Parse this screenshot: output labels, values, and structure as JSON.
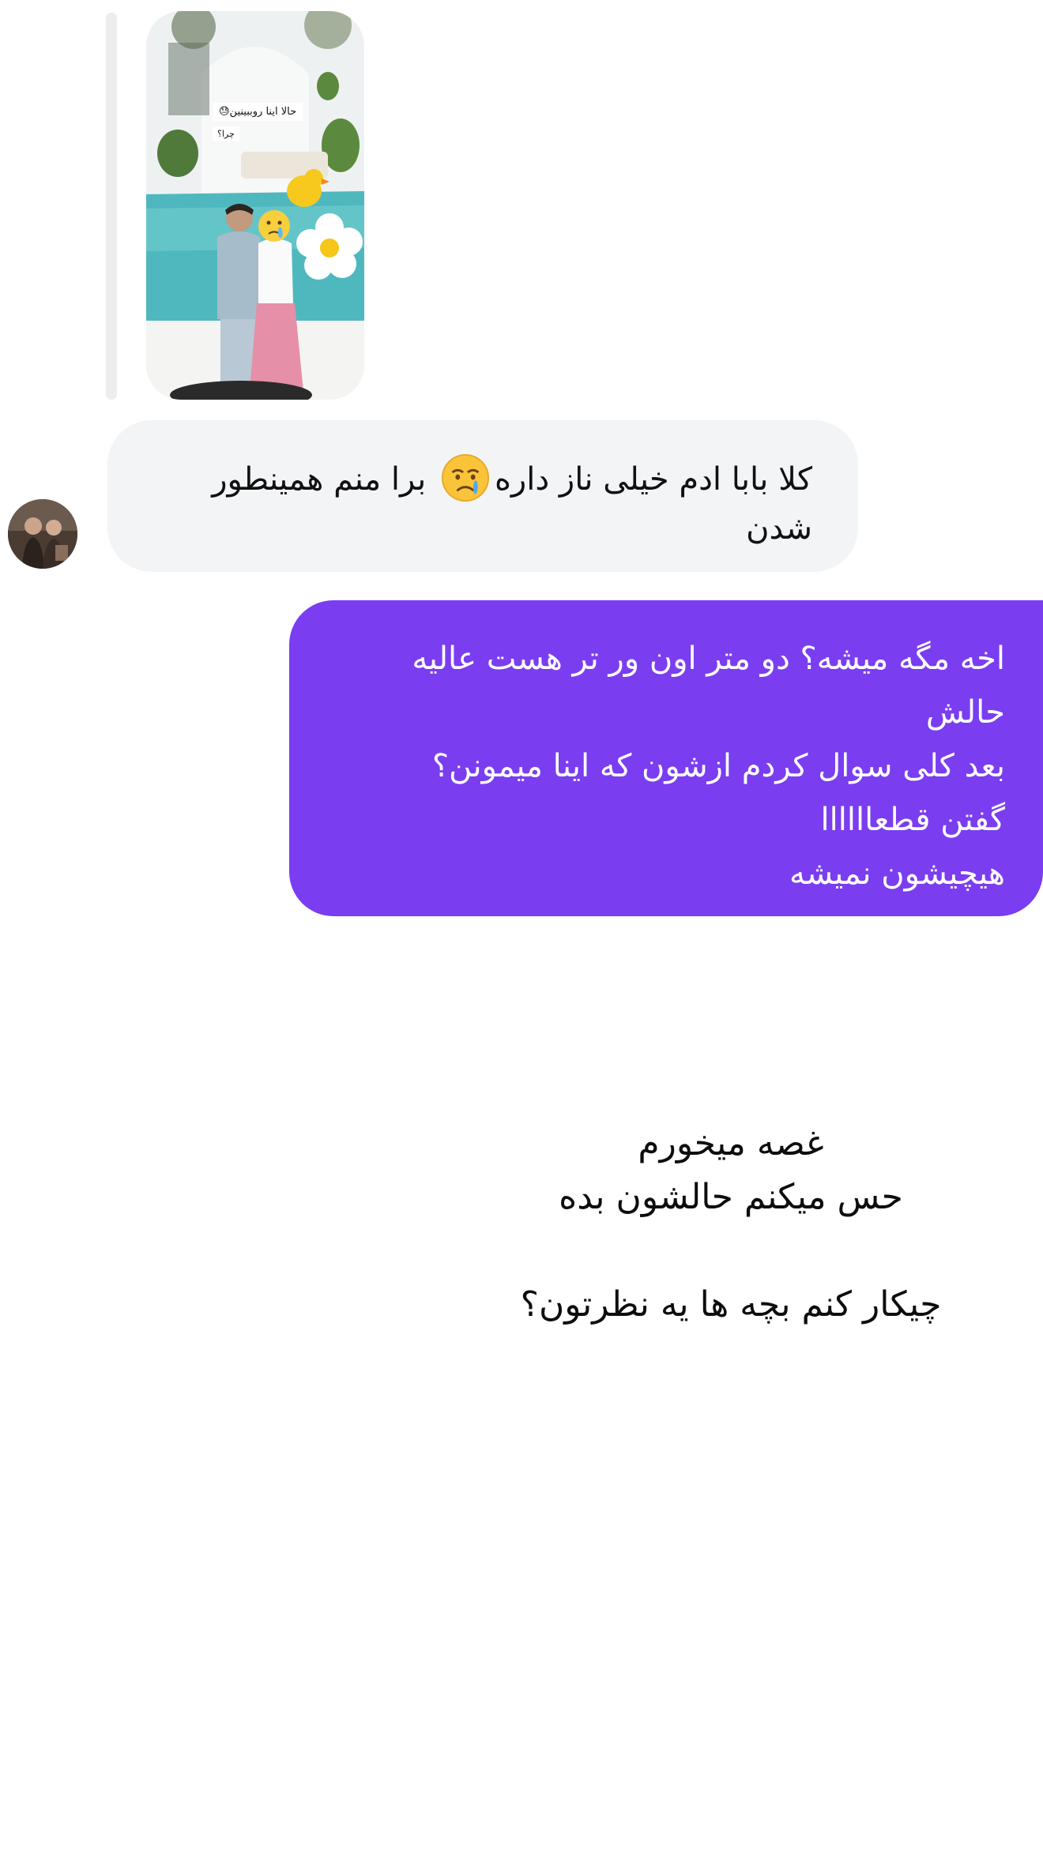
{
  "story": {
    "caption_line1": "حالا اینا روببینین😓",
    "caption_line2": "چرا؟"
  },
  "messages": [
    {
      "direction": "incoming",
      "text_before_emoji": "کلا بابا ادم خیلی ناز داره",
      "emoji": "crying-face",
      "text_after_emoji": " برا منم همینطور\nشدن"
    },
    {
      "direction": "outgoing",
      "text": "اخه مگه میشه؟ دو متر اون ور تر هست عالیه\nحالش\nبعد کلی سوال کردم ازشون که اینا میمونن؟\nگفتن قطعاااااا\nهیچیشون نمیشه"
    }
  ],
  "overlay": {
    "text": "غصه میخورم\nحس میکنم حالشون بده\n\nچیکار کنم بچه ها یه نظرتون؟"
  },
  "colors": {
    "incoming_bubble": "#f3f4f6",
    "outgoing_bubble": "#7a3df0",
    "thread_line": "#ededed"
  }
}
